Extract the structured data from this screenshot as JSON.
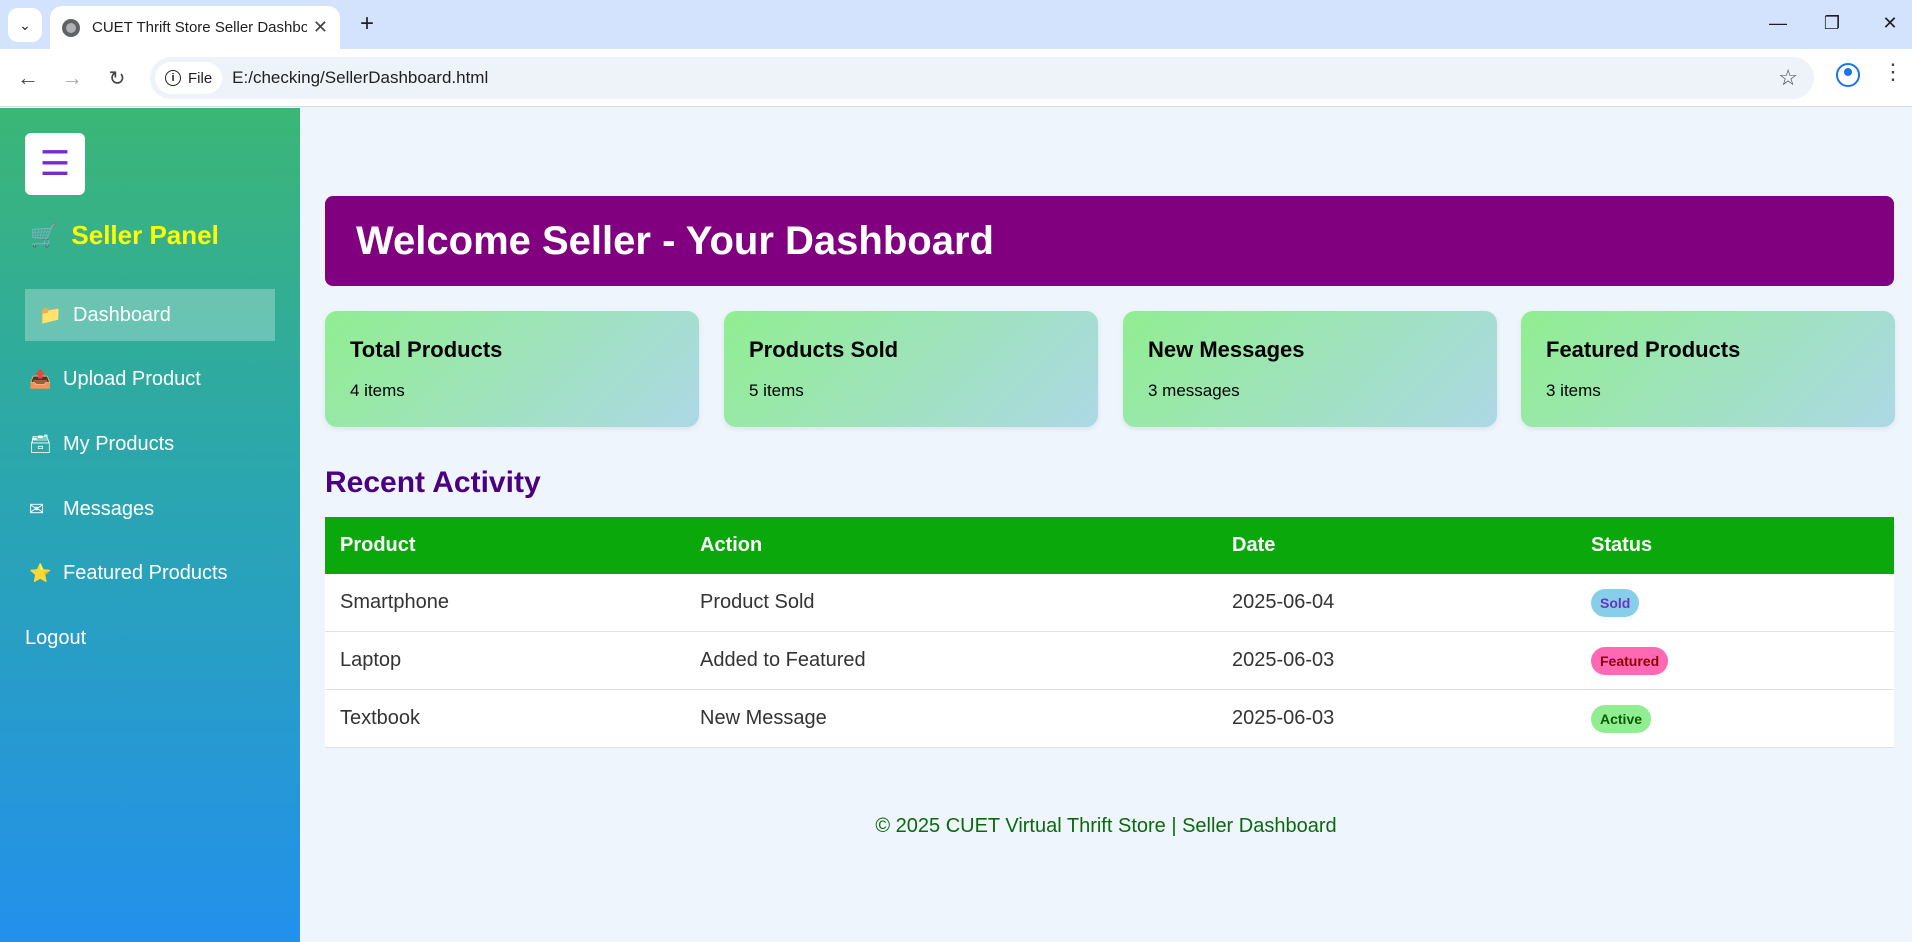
{
  "browser": {
    "tab_title": "CUET Thrift Store Seller Dashbo",
    "file_label": "File",
    "url": "E:/checking/SellerDashboard.html"
  },
  "sidebar": {
    "brand": "Seller Panel",
    "items": [
      {
        "icon": "📁",
        "label": "Dashboard"
      },
      {
        "icon": "📤",
        "label": "Upload Product"
      },
      {
        "icon": "🗃",
        "label": "My Products"
      },
      {
        "icon": "✉",
        "label": "Messages"
      },
      {
        "icon": "⭐",
        "label": "Featured Products"
      },
      {
        "icon": "",
        "label": "Logout"
      }
    ]
  },
  "welcome": {
    "title": "Welcome Seller - Your Dashboard"
  },
  "cards": [
    {
      "title": "Total Products",
      "value": "4 items"
    },
    {
      "title": "Products Sold",
      "value": "5 items"
    },
    {
      "title": "New Messages",
      "value": "3 messages"
    },
    {
      "title": "Featured Products",
      "value": "3 items"
    }
  ],
  "activity": {
    "title": "Recent Activity",
    "headers": [
      "Product",
      "Action",
      "Date",
      "Status"
    ],
    "rows": [
      {
        "product": "Smartphone",
        "action": "Product Sold",
        "date": "2025-06-04",
        "status": "Sold"
      },
      {
        "product": "Laptop",
        "action": "Added to Featured",
        "date": "2025-06-03",
        "status": "Featured"
      },
      {
        "product": "Textbook",
        "action": "New Message",
        "date": "2025-06-03",
        "status": "Active"
      }
    ]
  },
  "status_colors": {
    "Sold": {
      "bg": "#87ceeb",
      "fg": "#6a35b8"
    },
    "Featured": {
      "bg": "#ff69b4",
      "fg": "#8b0000"
    },
    "Active": {
      "bg": "#90ee90",
      "fg": "#0a5a0a"
    }
  },
  "footer": "© 2025 CUET Virtual Thrift Store | Seller Dashboard"
}
